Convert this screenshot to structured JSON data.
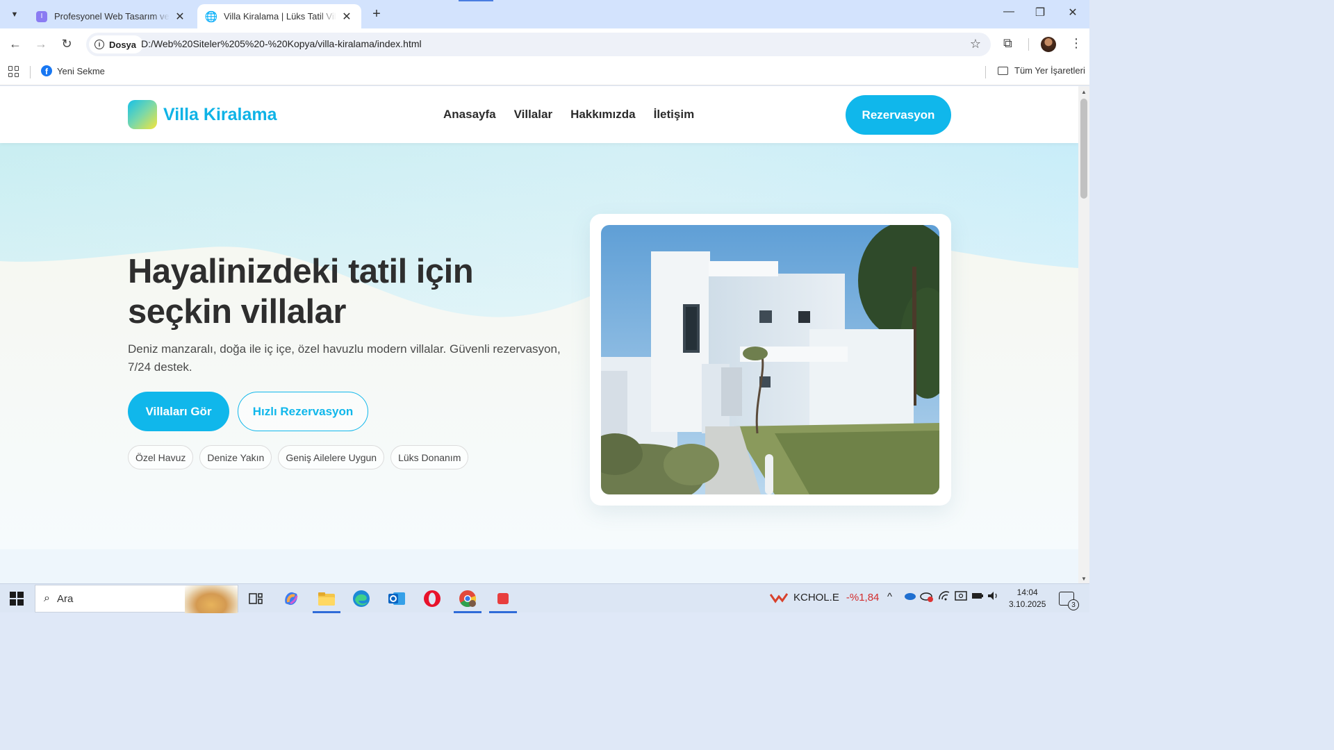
{
  "browser": {
    "tabs": [
      {
        "title": "Profesyonel Web Tasarım ve Dijital",
        "favicon": "I"
      },
      {
        "title": "Villa Kiralama | Lüks Tatil Villaları",
        "favicon": "globe-icon"
      }
    ],
    "chip_label": "Dosya",
    "url": "D:/Web%20Siteler%205%20-%20Kopya/villa-kiralama/index.html",
    "bookmarks": [
      {
        "label": "Yeni Sekme"
      }
    ],
    "all_bookmarks_label": "Tüm Yer İşaretleri"
  },
  "site": {
    "logo_text": "Villa Kiralama",
    "nav": [
      "Anasayfa",
      "Villalar",
      "Hakkımızda",
      "İletişim"
    ],
    "cta": "Rezervasyon",
    "hero": {
      "title": "Hayalinizdeki tatil için seçkin villalar",
      "subtitle": "Deniz manzaralı, doğa ile iç içe, özel havuzlu modern villalar. Güvenli rezervasyon, 7/24 destek.",
      "primary_button": "Villaları Gör",
      "secondary_button": "Hızlı Rezervasyon",
      "tags": [
        "Özel Havuz",
        "Denize Yakın",
        "Geniş Ailelere Uygun",
        "Lüks Donanım"
      ]
    },
    "accent_color": "#10b7eb"
  },
  "taskbar": {
    "search_placeholder": "Ara",
    "stock_symbol": "KCHOL.E",
    "stock_change": "-%1,84",
    "time": "14:04",
    "date": "3.10.2025",
    "notification_count": "3"
  }
}
